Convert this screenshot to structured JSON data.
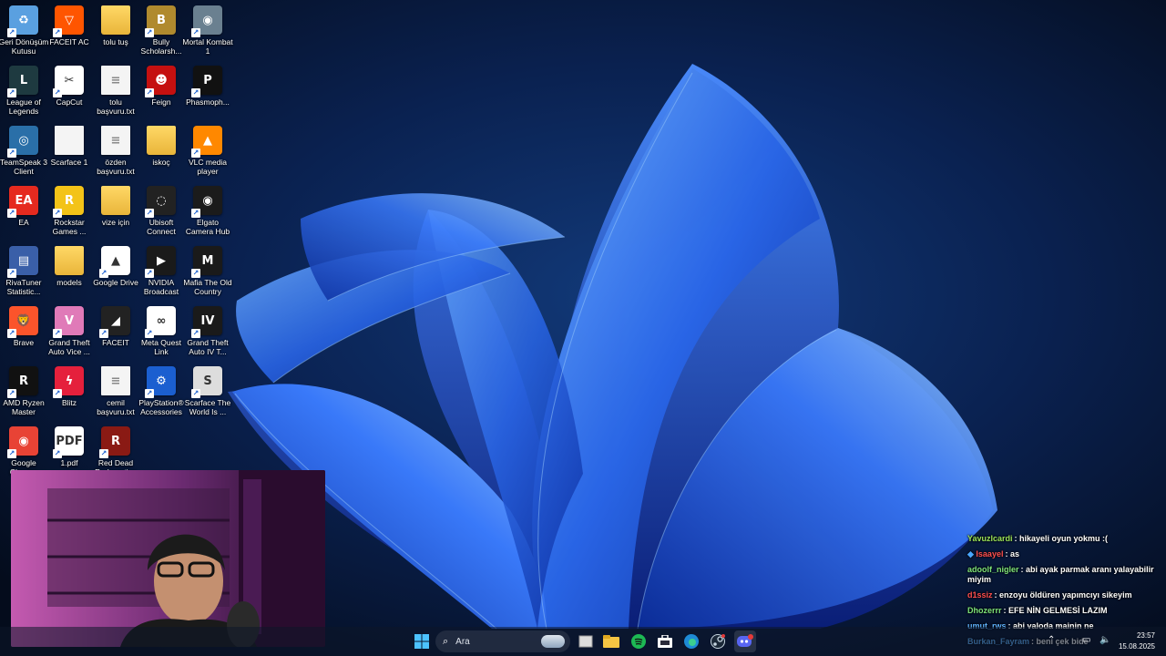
{
  "desktop": {
    "icons": [
      {
        "label": "Geri Dönüşüm Kutusu",
        "icon": "recycle-bin-icon",
        "color": "#5aa0e0",
        "glyph": "♻"
      },
      {
        "label": "FACEIT AC",
        "icon": "faceit-ac-icon",
        "color": "#ff5500",
        "glyph": "▽"
      },
      {
        "label": "tolu tuş",
        "icon": "folder-icon",
        "color": "#ffd866",
        "glyph": ""
      },
      {
        "label": "Bully Scholarsh...",
        "icon": "bully-icon",
        "color": "#b08a2e",
        "glyph": "B"
      },
      {
        "label": "Mortal Kombat 1",
        "icon": "mortal-kombat-icon",
        "color": "#6a8090",
        "glyph": "◉"
      },
      {
        "label": "League of Legends",
        "icon": "league-of-legends-icon",
        "color": "#1e3a40",
        "glyph": "L"
      },
      {
        "label": "CapCut",
        "icon": "capcut-icon",
        "color": "#ffffff",
        "glyph": "✂"
      },
      {
        "label": "tolu başvuru.txt",
        "icon": "text-file-icon",
        "color": "#f4f4f4",
        "glyph": "≡"
      },
      {
        "label": "Feign",
        "icon": "feign-icon",
        "color": "#c51010",
        "glyph": "☻"
      },
      {
        "label": "Phasmoph...",
        "icon": "phasmophobia-icon",
        "color": "#111111",
        "glyph": "P"
      },
      {
        "label": "TeamSpeak 3 Client",
        "icon": "teamspeak-icon",
        "color": "#2a6fa8",
        "glyph": "◎"
      },
      {
        "label": "Scarface 1",
        "icon": "blank-file-icon",
        "color": "#f4f4f4",
        "glyph": ""
      },
      {
        "label": "özden başvuru.txt",
        "icon": "text-file-icon",
        "color": "#f4f4f4",
        "glyph": "≡"
      },
      {
        "label": "iskoç",
        "icon": "folder-icon",
        "color": "#ffd866",
        "glyph": ""
      },
      {
        "label": "VLC media player",
        "icon": "vlc-icon",
        "color": "#ff8800",
        "glyph": "▲"
      },
      {
        "label": "EA",
        "icon": "ea-icon",
        "color": "#e52a1f",
        "glyph": "EA"
      },
      {
        "label": "Rockstar Games ...",
        "icon": "rockstar-icon",
        "color": "#f3c318",
        "glyph": "R"
      },
      {
        "label": "vize için",
        "icon": "folder-icon",
        "color": "#ffd866",
        "glyph": ""
      },
      {
        "label": "Ubisoft Connect",
        "icon": "ubisoft-icon",
        "color": "#222222",
        "glyph": "◌"
      },
      {
        "label": "Elgato Camera Hub",
        "icon": "elgato-icon",
        "color": "#1b1b1b",
        "glyph": "◉"
      },
      {
        "label": "RivaTuner Statistic...",
        "icon": "rivatuner-icon",
        "color": "#3a5fa8",
        "glyph": "▤"
      },
      {
        "label": "models",
        "icon": "folder-icon",
        "color": "#ffd866",
        "glyph": ""
      },
      {
        "label": "Google Drive",
        "icon": "google-drive-icon",
        "color": "#ffffff",
        "glyph": "▲"
      },
      {
        "label": "NVIDIA Broadcast",
        "icon": "nvidia-broadcast-icon",
        "color": "#1a1a1a",
        "glyph": "▶"
      },
      {
        "label": "Mafia The Old Country",
        "icon": "mafia-icon",
        "color": "#1a1a1a",
        "glyph": "M"
      },
      {
        "label": "Brave",
        "icon": "brave-icon",
        "color": "#fb542b",
        "glyph": "🦁"
      },
      {
        "label": "Grand Theft Auto Vice ...",
        "icon": "gta-vice-city-icon",
        "color": "#e07ab8",
        "glyph": "V"
      },
      {
        "label": "FACEIT",
        "icon": "faceit-icon",
        "color": "#222222",
        "glyph": "◢"
      },
      {
        "label": "Meta Quest Link",
        "icon": "meta-quest-icon",
        "color": "#ffffff",
        "glyph": "∞"
      },
      {
        "label": "Grand Theft Auto IV T...",
        "icon": "gta-iv-icon",
        "color": "#1a1a1a",
        "glyph": "IV"
      },
      {
        "label": "AMD Ryzen Master",
        "icon": "amd-ryzen-icon",
        "color": "#111111",
        "glyph": "R"
      },
      {
        "label": "Blitz",
        "icon": "blitz-icon",
        "color": "#e5203c",
        "glyph": "ϟ"
      },
      {
        "label": "cemil başvuru.txt",
        "icon": "text-file-icon",
        "color": "#f4f4f4",
        "glyph": "≡"
      },
      {
        "label": "PlayStation® Accessories",
        "icon": "playstation-icon",
        "color": "#1b5fd0",
        "glyph": "⚙"
      },
      {
        "label": "Scarface The World Is ...",
        "icon": "scarface-world-icon",
        "color": "#ddd",
        "glyph": "S"
      },
      {
        "label": "Google Chrome",
        "icon": "chrome-icon",
        "color": "#e84335",
        "glyph": "◉"
      },
      {
        "label": "1.pdf",
        "icon": "pdf-icon",
        "color": "#ffffff",
        "glyph": "PDF"
      },
      {
        "label": "Red Dead Redemption",
        "icon": "red-dead-icon",
        "color": "#8a1a14",
        "glyph": "R"
      }
    ]
  },
  "chat": {
    "messages": [
      {
        "user": "Yavuzlcardi",
        "color": "#9be35a",
        "text": "hikayeli oyun yokmu :("
      },
      {
        "user": "Isaayel",
        "color": "#ff4f4f",
        "text": "as",
        "badge": true
      },
      {
        "user": "adoolf_nigler",
        "color": "#7ee37a",
        "text": "abi ayak parmak aranı yalayabilir miyim"
      },
      {
        "user": "d1ssiz",
        "color": "#ff4f4f",
        "text": "enzoyu öldüren yapımcıyı sikeyim"
      },
      {
        "user": "Dhozerrr",
        "color": "#7ee37a",
        "text": "EFE NİN GELMESİ LAZIM"
      },
      {
        "user": "umut_rws",
        "color": "#5fb3ff",
        "text": "abi valoda mainin ne"
      },
      {
        "user": "Burkan_Fayram",
        "color": "#5fb3ff",
        "text": "beni çek bide"
      }
    ]
  },
  "taskbar": {
    "search_placeholder": "Ara",
    "time": "23:57",
    "date": "15.08.2025",
    "apps": [
      "start-icon",
      "task-view-icon",
      "file-explorer-icon",
      "spotify-icon",
      "store-icon",
      "edge-icon",
      "steam-icon",
      "discord-icon"
    ]
  },
  "colors": {
    "wallpaper_bg": "#07142b",
    "bloom": "#2f6df0"
  }
}
